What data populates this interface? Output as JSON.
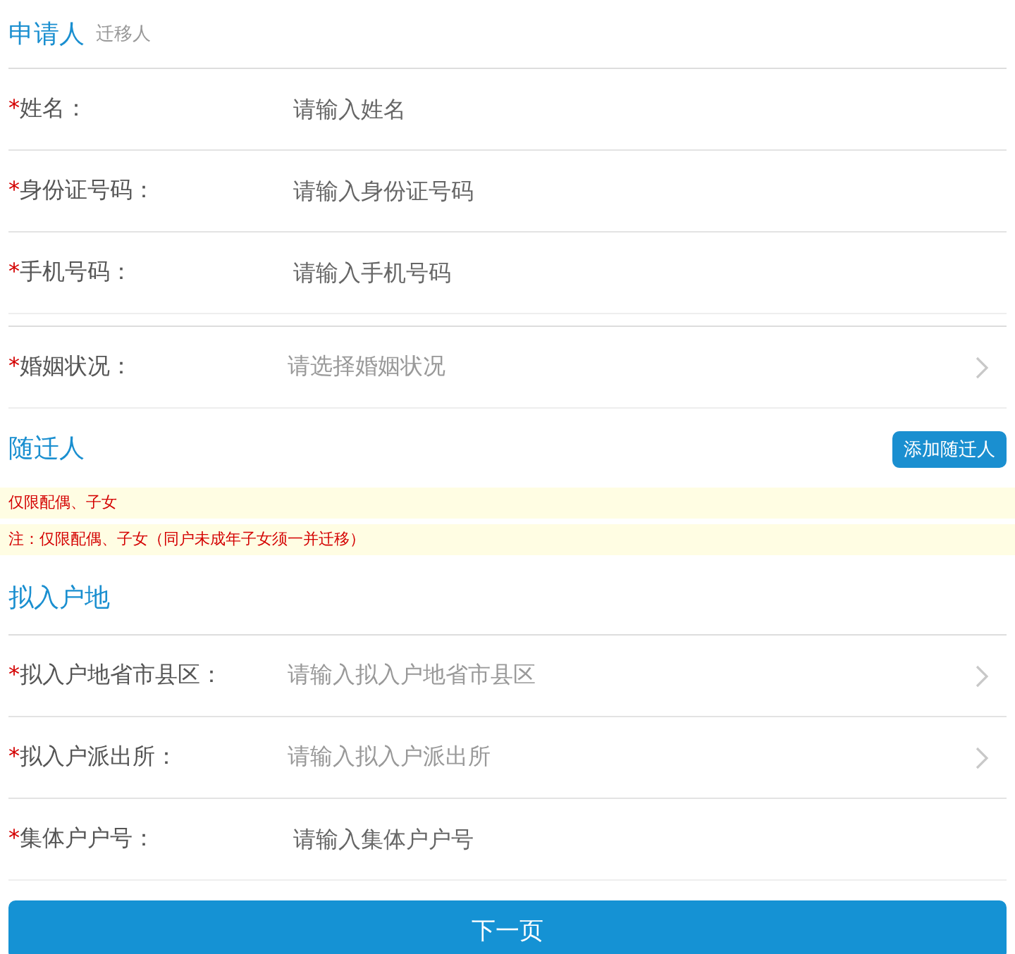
{
  "applicant": {
    "title": "申请人",
    "subtitle": "迁移人",
    "groups": [
      [
        {
          "kind": "input",
          "mark": "*",
          "label": "姓名：",
          "placeholder": "请输入姓名"
        },
        {
          "kind": "input",
          "mark": "*",
          "label": "身份证号码：",
          "placeholder": "请输入身份证号码"
        },
        {
          "kind": "input",
          "mark": "*",
          "label": "手机号码：",
          "placeholder": "请输入手机号码"
        }
      ],
      [
        {
          "kind": "select",
          "mark": "*",
          "label": "婚姻状况：",
          "placeholder": "请选择婚姻状况"
        }
      ]
    ]
  },
  "companions": {
    "title": "随迁人",
    "button": "添加随迁人",
    "notices": [
      "仅限配偶、子女",
      "注：仅限配偶、子女（同户未成年子女须一并迁移）"
    ]
  },
  "destination": {
    "title": "拟入户地",
    "fields": [
      {
        "kind": "select",
        "mark": "*",
        "label": "拟入户地省市县区：",
        "placeholder": "请输入拟入户地省市县区"
      },
      {
        "kind": "select",
        "mark": "*",
        "label": "拟入户派出所：",
        "placeholder": "请输入拟入户派出所"
      },
      {
        "kind": "input",
        "mark": "*",
        "label": "集体户户号：",
        "placeholder": "请输入集体户户号"
      }
    ]
  },
  "next_button": "下一页"
}
